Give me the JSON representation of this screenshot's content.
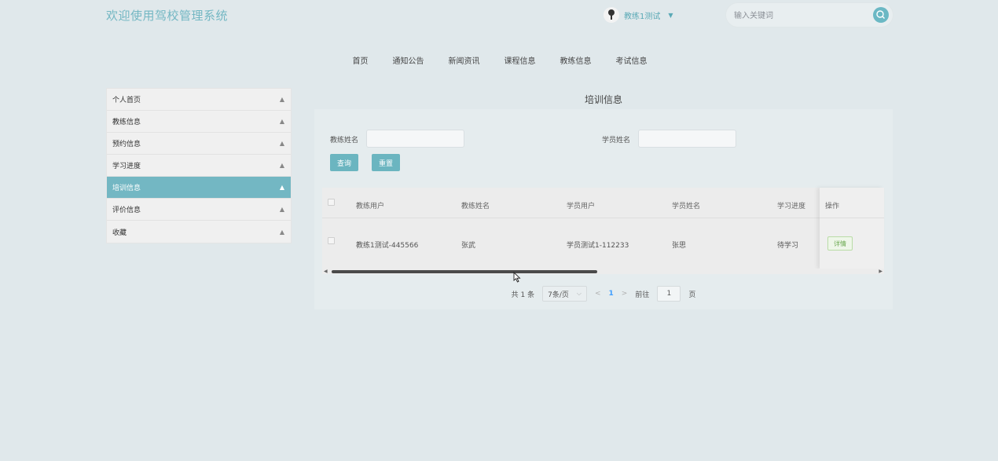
{
  "header": {
    "site_title": "欢迎使用驾校管理系统",
    "user_name": "教练1测试",
    "search_placeholder": "输入关键词"
  },
  "nav": [
    "首页",
    "通知公告",
    "新闻资讯",
    "课程信息",
    "教练信息",
    "考试信息"
  ],
  "sidebar": {
    "items": [
      {
        "label": "个人首页"
      },
      {
        "label": "教练信息"
      },
      {
        "label": "预约信息"
      },
      {
        "label": "学习进度"
      },
      {
        "label": "培训信息"
      },
      {
        "label": "评价信息"
      },
      {
        "label": "收藏"
      }
    ],
    "active_index": 4
  },
  "main": {
    "heading": "培训信息",
    "filter": {
      "coach_name_label": "教练姓名",
      "student_name_label": "学员姓名",
      "query_label": "查询",
      "reset_label": "重置"
    },
    "table": {
      "headers": [
        "教练用户",
        "教练姓名",
        "学员用户",
        "学员姓名",
        "学习进度",
        "操作"
      ],
      "rows": [
        {
          "coach_user": "教练1测试-445566",
          "coach_name": "张武",
          "student_user": "学员测试1-112233",
          "student_name": "张思",
          "progress": "待学习",
          "action": "详情"
        }
      ]
    },
    "pager": {
      "total": "共 1 条",
      "page_size": "7条/页",
      "current_page": "1",
      "goto_label": "前往",
      "goto_value": "1",
      "page_suffix": "页"
    }
  },
  "colors": {
    "accent": "#73b7c3",
    "background": "#e0e8eb",
    "detail_green": "#6aa84f"
  }
}
